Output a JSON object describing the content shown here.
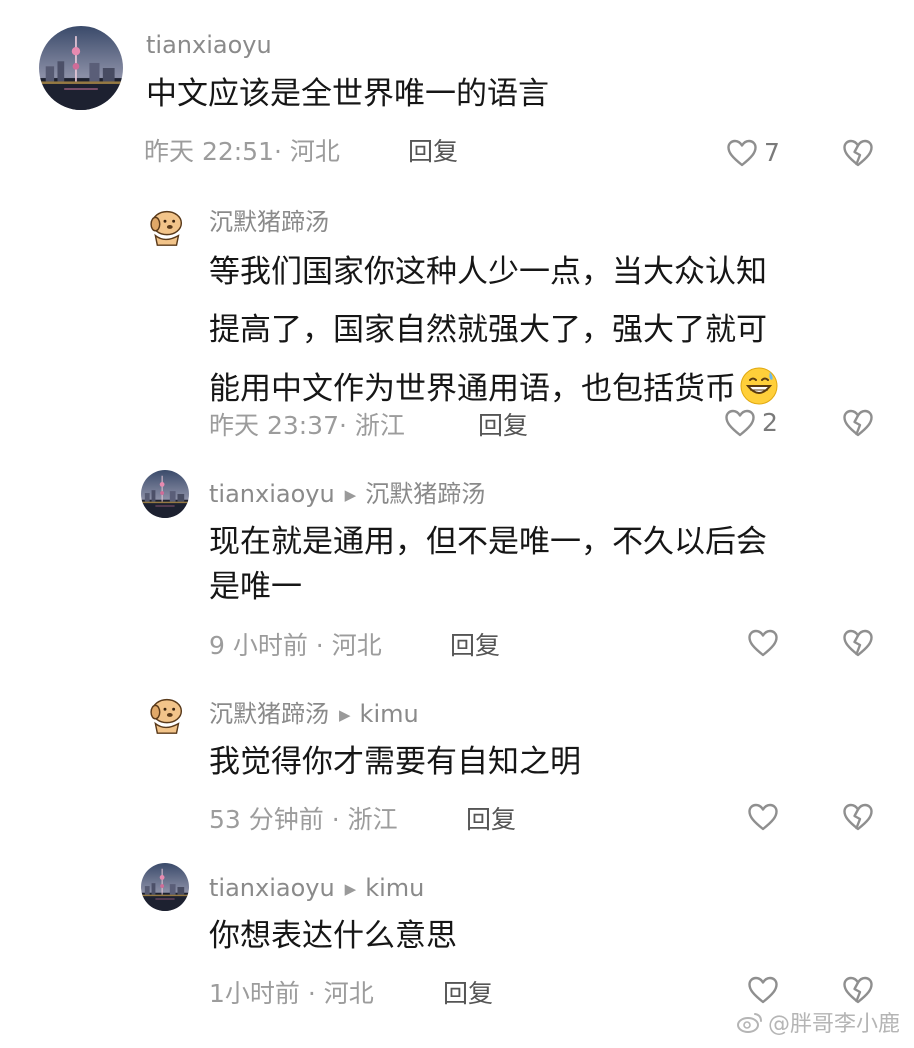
{
  "comments": [
    {
      "user": "tianxiaoyu",
      "reply_to": "",
      "lines": [
        "中文应该是全世界唯一的语言"
      ],
      "time": "昨天 22:51· 河北",
      "reply_label": "回复",
      "likes": "7",
      "avatar": "city-skyline"
    },
    {
      "user": "沉默猪蹄汤",
      "reply_to": "",
      "lines": [
        "等我们国家你这种人少一点，当大众认知",
        "提高了，国家自然就强大了，强大了就可",
        "能用中文作为世界通用语，也包括货币"
      ],
      "emoji": "grinning-sweat-emoji",
      "time": "昨天 23:37· 浙江",
      "reply_label": "回复",
      "likes": "2",
      "avatar": "cartoon-dog"
    },
    {
      "user": "tianxiaoyu",
      "reply_to": "沉默猪蹄汤",
      "lines": [
        "现在就是通用，但不是唯一，不久以后会",
        "是唯一"
      ],
      "time": "9 小时前 · 河北",
      "reply_label": "回复",
      "likes": "",
      "avatar": "city-skyline"
    },
    {
      "user": "沉默猪蹄汤",
      "reply_to": "kimu",
      "lines": [
        "我觉得你才需要有自知之明"
      ],
      "time": "53 分钟前 · 浙江",
      "reply_label": "回复",
      "likes": "",
      "avatar": "cartoon-dog"
    },
    {
      "user": "tianxiaoyu",
      "reply_to": "kimu",
      "lines": [
        "你想表达什么意思"
      ],
      "time": "1小时前 · 河北",
      "reply_label": "回复",
      "likes": "",
      "avatar": "city-skyline"
    }
  ],
  "watermark": "@胖哥李小鹿",
  "colors": {
    "text": "#161616",
    "meta": "#9c9c9c",
    "icon": "#8f8f8f"
  }
}
